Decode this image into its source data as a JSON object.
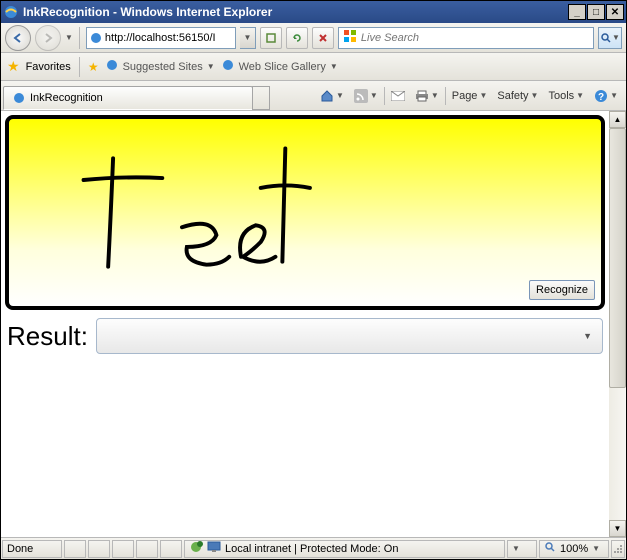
{
  "window": {
    "title": "InkRecognition - Windows Internet Explorer"
  },
  "nav": {
    "url": "http://localhost:56150/I",
    "search_placeholder": "Live Search"
  },
  "favorites": {
    "label": "Favorites",
    "suggested": "Suggested Sites",
    "gallery": "Web Slice Gallery"
  },
  "tab": {
    "title": "InkRecognition"
  },
  "commands": {
    "page": "Page",
    "safety": "Safety",
    "tools": "Tools"
  },
  "app": {
    "recognize_label": "Recognize",
    "result_label": "Result:",
    "ink_text_semantic": "Test"
  },
  "status": {
    "done": "Done",
    "zone": "Local intranet | Protected Mode: On",
    "zoom": "100%"
  },
  "colors": {
    "canvas_top": "#ffff00",
    "canvas_bottom": "#ffffff",
    "canvas_border": "#000000",
    "titlebar": "#2a4a87"
  }
}
